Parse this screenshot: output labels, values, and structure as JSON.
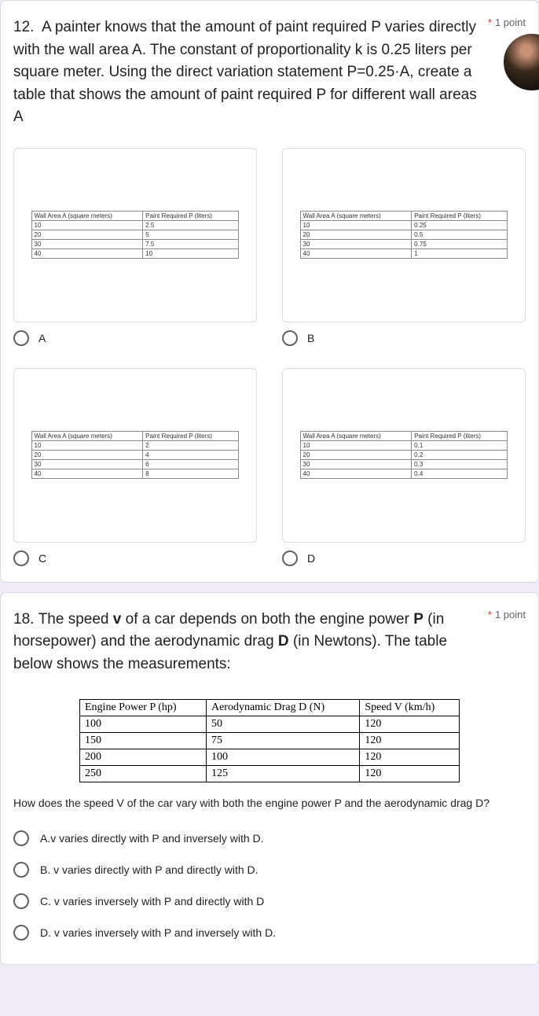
{
  "q12": {
    "number": "12.",
    "text": "A painter knows that the amount of paint required P varies directly with the wall area A. The constant of proportionality k is 0.25 liters per square meter. Using the direct variation statement P=0.25·A, create a table that shows the amount of paint required P for different wall areas A",
    "points": "1 point",
    "option_headers": {
      "area": "Wall Area A (square meters)",
      "paint": "Paint Required P (liters)"
    },
    "chart_data": [
      {
        "label": "A",
        "type": "table",
        "rows": [
          [
            "10",
            "2.5"
          ],
          [
            "20",
            "5"
          ],
          [
            "30",
            "7.5"
          ],
          [
            "40",
            "10"
          ]
        ]
      },
      {
        "label": "B",
        "type": "table",
        "rows": [
          [
            "10",
            "0.25"
          ],
          [
            "20",
            "0.5"
          ],
          [
            "30",
            "0.75"
          ],
          [
            "40",
            "1"
          ]
        ]
      },
      {
        "label": "C",
        "type": "table",
        "rows": [
          [
            "10",
            "2"
          ],
          [
            "20",
            "4"
          ],
          [
            "30",
            "6"
          ],
          [
            "40",
            "8"
          ]
        ]
      },
      {
        "label": "D",
        "type": "table",
        "rows": [
          [
            "10",
            "0.1"
          ],
          [
            "20",
            "0.2"
          ],
          [
            "30",
            "0.3"
          ],
          [
            "40",
            "0.4"
          ]
        ]
      }
    ]
  },
  "q18": {
    "number": "18.",
    "text_parts": [
      "The speed ",
      " of a car depends on both the engine power ",
      " (in horsepower) and the aerodynamic   drag ",
      " (in Newtons). The table below shows the measurements:"
    ],
    "bolds": [
      "v",
      "P",
      "D"
    ],
    "points": "1 point",
    "sub_question": "How does the speed V of the car vary with both the engine power P and the aerodynamic drag D?",
    "chart_data": {
      "type": "table",
      "headers": [
        "Engine Power P (hp)",
        "Aerodynamic Drag D (N)",
        "Speed V (km/h)"
      ],
      "rows": [
        [
          "100",
          "50",
          "120"
        ],
        [
          "150",
          "75",
          "120"
        ],
        [
          "200",
          "100",
          "120"
        ],
        [
          "250",
          "125",
          "120"
        ]
      ]
    },
    "options": [
      "A.v varies directly with P and inversely with D.",
      "B. v varies directly with P and directly with D.",
      "C. v varies inversely with P and directly with D",
      "D. v varies inversely with P and inversely with D."
    ]
  }
}
